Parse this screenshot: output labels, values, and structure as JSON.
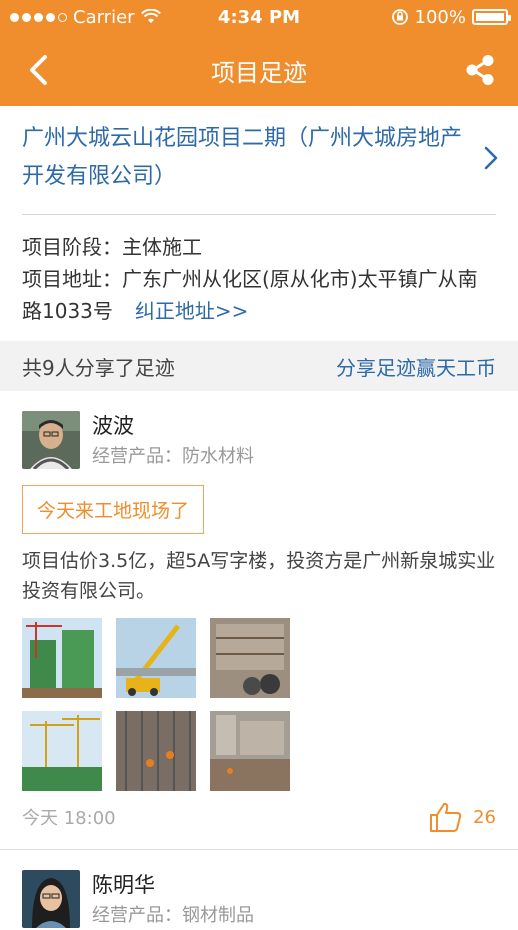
{
  "status_bar": {
    "carrier": "Carrier",
    "time": "4:34 PM",
    "battery": "100%"
  },
  "nav": {
    "title": "项目足迹",
    "back_icon": "chevron-left-icon",
    "share_icon": "share-icon"
  },
  "project": {
    "name": "广州大城云山花园项目二期（广州大城房地产开发有限公司）",
    "stage_label": "项目阶段：",
    "stage_value": "主体施工",
    "address_label": "项目地址：",
    "address_value": "广东广州从化区(原从化市)太平镇广从南路1033号",
    "fix_address_link": "纠正地址>>"
  },
  "share_bar": {
    "count_text": "共9人分享了足迹",
    "earn_link": "分享足迹赢天工币"
  },
  "posts": [
    {
      "user": "波波",
      "product": "经营产品：防水材料",
      "tag": "今天来工地现场了",
      "text": "项目估价3.5亿，超5A写字楼，投资方是广州新泉城实业投资有限公司。",
      "time": "今天 18:00",
      "likes": "26"
    },
    {
      "user": "陈明华",
      "product": "经营产品：钢材制品"
    }
  ],
  "colors": {
    "accent": "#f08d2c",
    "link": "#2e6aa8"
  }
}
